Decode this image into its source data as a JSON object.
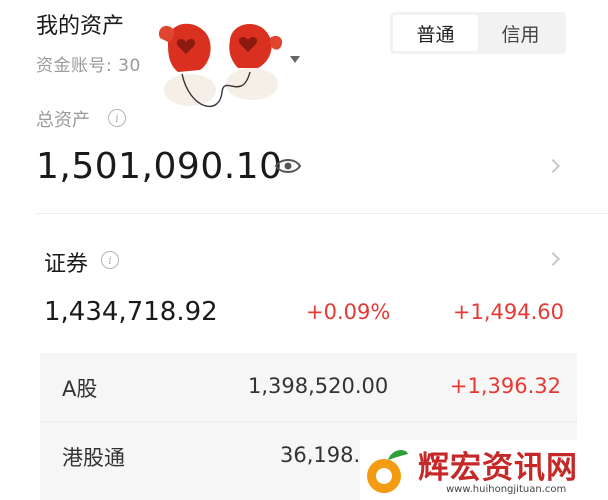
{
  "header": {
    "title": "我的资产",
    "account_label": "资金账号: 30",
    "tabs": [
      {
        "label": "普通",
        "active": true
      },
      {
        "label": "信用",
        "active": false
      }
    ]
  },
  "total_assets": {
    "label": "总资产",
    "value": "1,501,090.10"
  },
  "securities": {
    "label": "证券",
    "value": "1,434,718.92",
    "change_pct": "+0.09%",
    "profit_loss": "+1,494.60",
    "rows": [
      {
        "name": "A股",
        "value": "1,398,520.00",
        "profit_loss": "+1,396.32"
      },
      {
        "name": "港股通",
        "value": "36,198.",
        "profit_loss": ""
      }
    ]
  },
  "watermark": {
    "brand": "辉宏资讯网",
    "url": "www.huihongjituan.com"
  },
  "colors": {
    "gain": "#e53935",
    "muted": "#9a9a9a",
    "panel_bg": "#f6f6f6"
  }
}
